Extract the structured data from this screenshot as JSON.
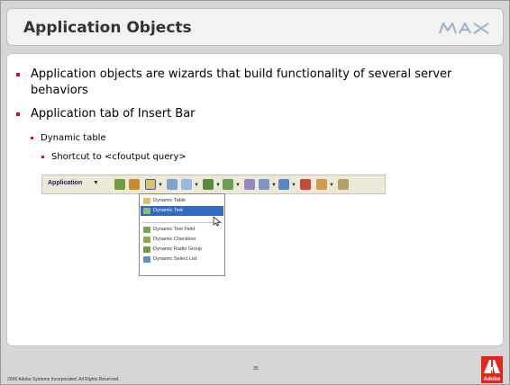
{
  "slide": {
    "title": "Application Objects",
    "bullets": [
      "Application objects are wizards that build functionality of several server behaviors",
      "Application tab of Insert Bar"
    ],
    "sub_bullet": "Dynamic table",
    "sub_sub_bullet": "Shortcut to <cfoutput query>"
  },
  "insert_bar": {
    "tab_label": "Application",
    "dropdown_arrow": "▼"
  },
  "menu": {
    "items": [
      "Dynamic Table",
      "Dynamic Text",
      "Dynamic Text Field",
      "Dynamic Checkbox",
      "Dynamic Radio Group",
      "Dynamic Select List"
    ],
    "selected": "Dynamic Text"
  },
  "footer": {
    "copyright": "2006 Adobe Systems Incorporated.  All Rights Reserved.",
    "page_number": "35",
    "logo_text": "Adobe"
  },
  "colors": {
    "bullet": "#c41230",
    "adobe_red": "#e2261b",
    "selection": "#316ac5"
  }
}
